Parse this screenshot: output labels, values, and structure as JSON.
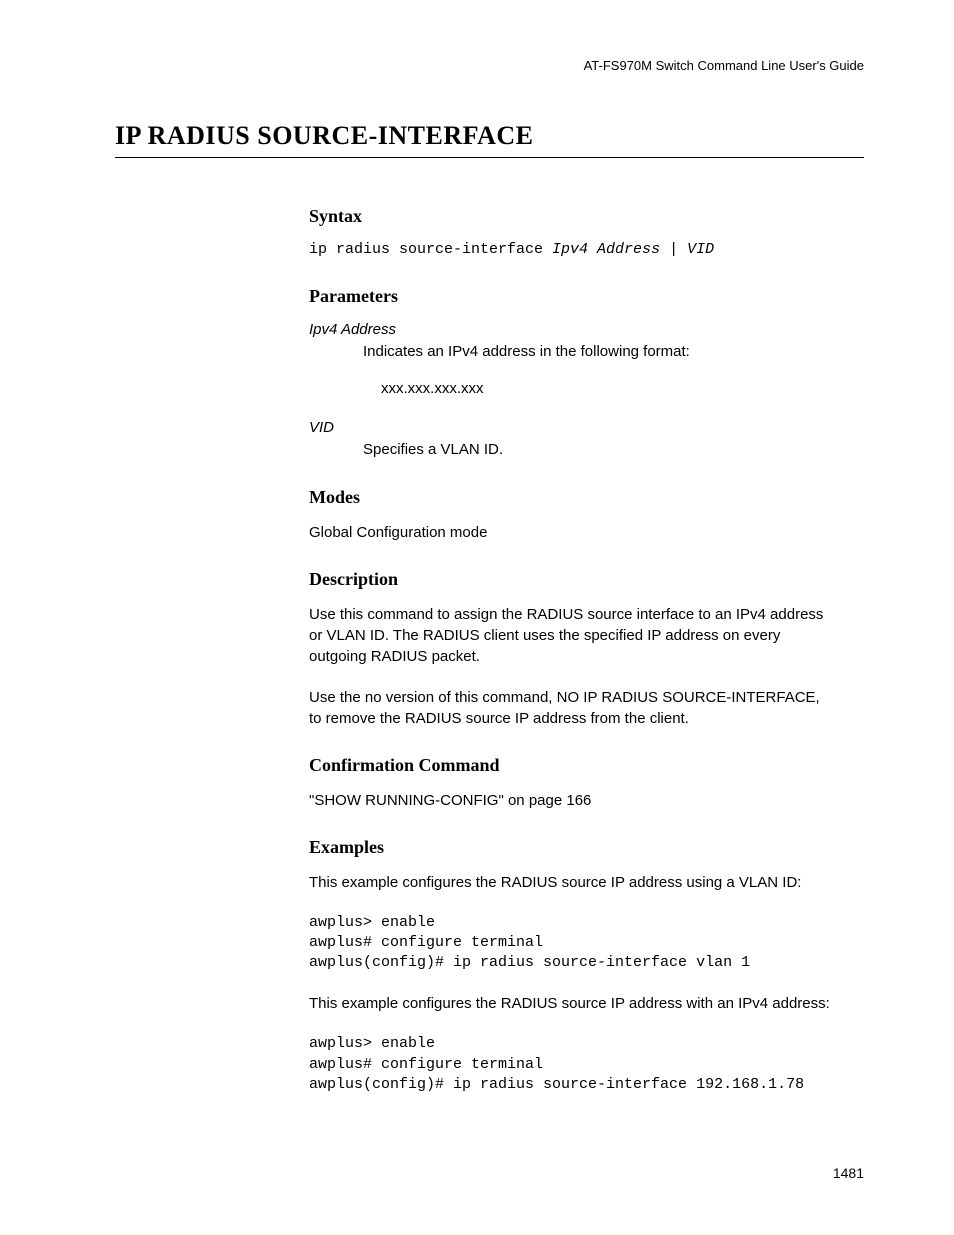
{
  "header": {
    "guide_title": "AT-FS970M Switch Command Line User's Guide"
  },
  "title": "IP RADIUS SOURCE-INTERFACE",
  "sections": {
    "syntax": {
      "heading": "Syntax",
      "command": "ip radius source-interface ",
      "params": "Ipv4 Address",
      "separator": " | ",
      "params2": "VID"
    },
    "parameters": {
      "heading": "Parameters",
      "param1": {
        "name": "Ipv4 Address",
        "desc": "Indicates an IPv4 address in the following format:",
        "format": "xxx.xxx.xxx.xxx"
      },
      "param2": {
        "name": "VID",
        "desc": "Specifies a VLAN ID."
      }
    },
    "modes": {
      "heading": "Modes",
      "text": "Global Configuration mode"
    },
    "description": {
      "heading": "Description",
      "para1": "Use this command to assign the RADIUS source interface to an IPv4 address or VLAN ID. The RADIUS client uses the specified IP address on every outgoing RADIUS packet.",
      "para2": "Use the no version of this command, NO IP RADIUS SOURCE-INTERFACE, to remove the RADIUS source IP address from the client."
    },
    "confirmation": {
      "heading": "Confirmation Command",
      "text": "\"SHOW RUNNING-CONFIG\" on page 166"
    },
    "examples": {
      "heading": "Examples",
      "intro1": "This example configures the RADIUS source IP address using a VLAN ID:",
      "code1": "awplus> enable\nawplus# configure terminal\nawplus(config)# ip radius source-interface vlan 1",
      "intro2": "This example configures the RADIUS source IP address with an IPv4 address:",
      "code2": "awplus> enable\nawplus# configure terminal\nawplus(config)# ip radius source-interface 192.168.1.78"
    }
  },
  "page_number": "1481"
}
